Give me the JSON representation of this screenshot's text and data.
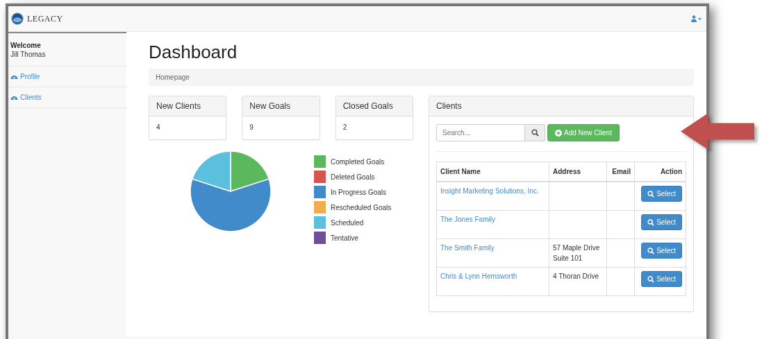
{
  "navbar": {
    "brand": "LEGACY"
  },
  "sidebar": {
    "welcome": "Welcome",
    "user": "Jill Thomas",
    "items": [
      {
        "label": "Profile"
      },
      {
        "label": "Clients"
      }
    ]
  },
  "page": {
    "title": "Dashboard",
    "breadcrumb": "Homepage"
  },
  "stats": [
    {
      "title": "New Clients",
      "value": "4"
    },
    {
      "title": "New Goals",
      "value": "9"
    },
    {
      "title": "Closed Goals",
      "value": "2"
    }
  ],
  "legend": [
    {
      "label": "Completed Goals",
      "color": "#5cb85c"
    },
    {
      "label": "Deleted Goals",
      "color": "#d9534f"
    },
    {
      "label": "In Progress Goals",
      "color": "#428bca"
    },
    {
      "label": "Rescheduled Goals",
      "color": "#f0ad4e"
    },
    {
      "label": "Scheduled",
      "color": "#5bc0de"
    },
    {
      "label": "Tentative",
      "color": "#6f4e9c"
    }
  ],
  "clients_panel": {
    "title": "Clients",
    "search": {
      "placeholder": "Search..."
    },
    "add_button": "Add New Client",
    "table": {
      "columns": [
        "Client Name",
        "Address",
        "Email",
        "Action"
      ],
      "rows": [
        {
          "name": "Insight Marketing Solutions, Inc.",
          "address": [],
          "action": "Select"
        },
        {
          "name": "The Jones Family",
          "address": [],
          "action": "Select"
        },
        {
          "name": "The Smith Family",
          "address": [
            "57 Maple Drive",
            "Suite 101"
          ],
          "action": "Select"
        },
        {
          "name": "Chris & Lynn Hemsworth",
          "address": [
            "4 Thoran Drive"
          ],
          "action": "Select"
        }
      ]
    }
  }
}
